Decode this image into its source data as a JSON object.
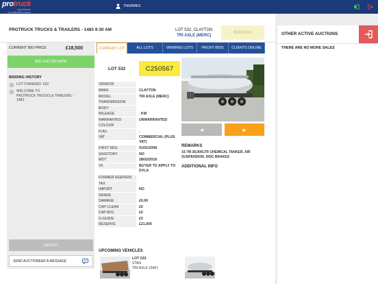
{
  "topbar": {
    "logo_main_1": "pro",
    "logo_main_2": "truck",
    "logo_sub_1": "ELECTRONIC",
    "logo_sub_2": "an ATA/BUYER company",
    "user_name": "TIMJAMES",
    "colors": {
      "bar": "#1c3a78",
      "logo_accent": "#e8473b"
    }
  },
  "header": {
    "title": "PROTRUCK TRUCKS & TRAILERS - 1483 9:30 AM",
    "lot_line1": "LOT 532, CLAYTON",
    "lot_line2": "TRI AXLE (MERC)",
    "status": "BIDDING"
  },
  "bidpanel": {
    "current_bid_label": "CURRENT BID PRICE",
    "current_bid_value": "£18,500",
    "bid_button": "BID £18,750 NOW",
    "history_title": "BIDDING HISTORY",
    "history": [
      {
        "text1": "LOT CHANGED: 532",
        "text2": ""
      },
      {
        "text1": "WELCOME TO",
        "text2": "PROTRUCK TRUCKS & TRAILERS -",
        "text3": "1483"
      }
    ],
    "im_out": "I'M OUT",
    "send_message": "SEND AUCTIONEER A MESSAGE"
  },
  "tabs": [
    {
      "label": "CURRENT LOT",
      "active": true
    },
    {
      "label": "ALL LOTS",
      "active": false
    },
    {
      "label": "WINNING LOTS",
      "active": false
    },
    {
      "label": "PROXY BIDS",
      "active": false
    },
    {
      "label": "CLIENTS ONLINE",
      "active": false
    }
  ],
  "lot": {
    "number_label": "LOT 532",
    "code": "C250567",
    "prev": "◄",
    "next": "►"
  },
  "specs": [
    {
      "label": "VENDOR",
      "value": ""
    },
    {
      "label": "MAKE",
      "value": "CLAYTON"
    },
    {
      "label": "MODEL",
      "value": "TRI AXLE (MERC)"
    },
    {
      "label": "TRANSMISSION",
      "value": ""
    },
    {
      "label": "BODY",
      "value": ""
    },
    {
      "label": "MILEAGE",
      "value": ". KM"
    },
    {
      "label": "WARRANTED",
      "value": "UNWARRANTED"
    },
    {
      "label": "COLOUR",
      "value": ""
    },
    {
      "label": "FUEL",
      "value": "."
    },
    {
      "label": "VAT",
      "value": "COMMERCIAL (PLUS VAT)"
    },
    {
      "label": "FIRST REG",
      "value": "01/01/2008"
    },
    {
      "label": "S/HISTORY",
      "value": "NO"
    },
    {
      "label": "MOT",
      "value": "28/02/2018"
    },
    {
      "label": "V5",
      "value": "BUYER TO APPLY TO DVLA"
    },
    {
      "label": "FORMER KEEPERS",
      "value": ""
    },
    {
      "label": "TAX",
      "value": ""
    },
    {
      "label": "IMPORT",
      "value": "NO"
    },
    {
      "label": "GRADE",
      "value": ""
    },
    {
      "label": "DAMAGE",
      "value": "£0.00"
    },
    {
      "label": "CAP CLEAN",
      "value": "£0"
    },
    {
      "label": "CAP AVG",
      "value": "£0"
    },
    {
      "label": "G-GUIDE",
      "value": "£0"
    },
    {
      "label": "RESERVE",
      "value": "£21,000"
    }
  ],
  "remarks": {
    "title": "REMARKS",
    "body": "10.7M 38,000LTR CHEMICAL TANKER, AIR SUSPENSION, DISC BRAKES",
    "additional_title": "ADDITIONAL INFO"
  },
  "upcoming": {
    "title": "UPCOMING VEHICLES",
    "items": [
      {
        "lot": "LOT 533",
        "make": "STAS",
        "model": "TRI AXLE (SAF)"
      }
    ]
  },
  "other_auctions": {
    "title": "OTHER ACTIVE AUCTIONS",
    "empty": "THERE ARE NO MORE SALES"
  }
}
